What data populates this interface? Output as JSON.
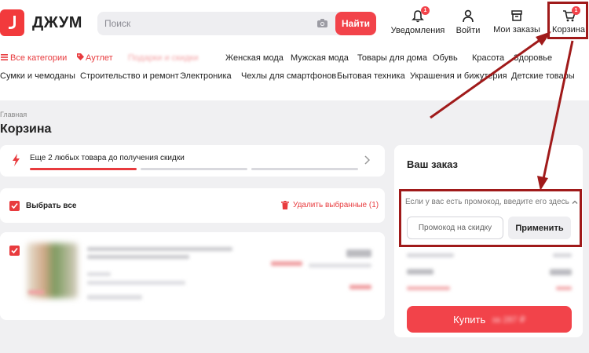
{
  "header": {
    "logo_text": "ДЖУМ",
    "search_placeholder": "Поиск",
    "search_button": "Найти",
    "notifications_label": "Уведомления",
    "notifications_badge": "1",
    "login_label": "Войти",
    "orders_label": "Мои заказы",
    "cart_label": "Корзина",
    "cart_badge": "1"
  },
  "nav": {
    "row1": {
      "all_categories": "Все категории",
      "outlet": "Аутлет",
      "promo_blurred": "Подарки и скидки",
      "women": "Женская мода",
      "men": "Мужская мода",
      "home": "Товары для дома",
      "shoes": "Обувь",
      "beauty": "Красота",
      "health": "Здоровье"
    },
    "row2": {
      "bags": "Сумки и чемоданы",
      "construction": "Строительство и ремонт",
      "electronics": "Электроника",
      "cases": "Чехлы для смартфонов",
      "appliances": "Бытовая техника",
      "jewelry": "Украшения и бижутерия",
      "kids": "Детские товары"
    }
  },
  "breadcrumb": "Главная",
  "page_title": "Корзина",
  "progress": {
    "text": "Еще 2 любых товара до получения скидки",
    "filled_segments": 1,
    "total_segments": 3
  },
  "selection": {
    "select_all": "Выбрать все",
    "delete_selected": "Удалить выбранные (1)"
  },
  "summary": {
    "title": "Ваш заказ",
    "promo_prompt": "Если у вас есть промокод, введите его здесь",
    "promo_placeholder": "Промокод на скидку",
    "apply_button": "Применить",
    "buy_button": "Купить"
  },
  "colors": {
    "accent": "#f2434a",
    "annotation": "#a01a1a"
  }
}
